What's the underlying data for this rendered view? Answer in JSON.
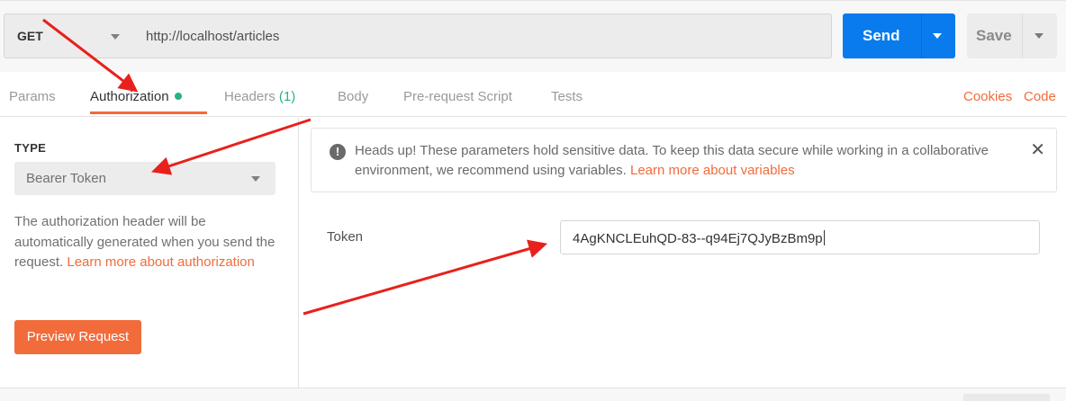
{
  "request": {
    "method": "GET",
    "url": "http://localhost/articles",
    "send_label": "Send",
    "save_label": "Save"
  },
  "tabs": [
    {
      "label": "Params"
    },
    {
      "label": "Authorization"
    },
    {
      "label": "Headers",
      "count": "(1)"
    },
    {
      "label": "Body"
    },
    {
      "label": "Pre-request Script"
    },
    {
      "label": "Tests"
    }
  ],
  "right_links": {
    "cookies": "Cookies",
    "code": "Code"
  },
  "auth": {
    "type_label": "TYPE",
    "type_value": "Bearer Token",
    "desc_text": "The authorization header will be automatically generated when you send the request.",
    "desc_link": "Learn more about authorization",
    "preview_button": "Preview Request"
  },
  "notice": {
    "text": "Heads up! These parameters hold sensitive data. To keep this data secure while working in a collaborative environment, we recommend using variables.",
    "link": "Learn more about variables"
  },
  "token": {
    "label": "Token",
    "value": "4AgKNCLEuhQD-83--q94Ej7QJyBzBm9p"
  },
  "colors": {
    "accent": "#f26b3a",
    "send": "#097bed",
    "status_green": "#26b47f",
    "annotation_red": "#e8211c"
  }
}
